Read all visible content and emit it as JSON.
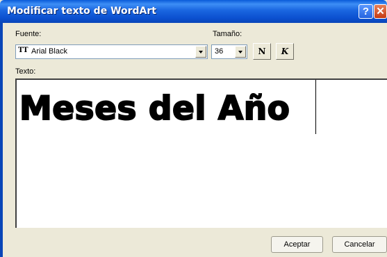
{
  "window": {
    "title": "Modificar texto de WordArt",
    "help_glyph": "?",
    "close_glyph": "✕"
  },
  "font": {
    "label": "Fuente:",
    "value": "Arial Black",
    "icon_glyph": "TT"
  },
  "size": {
    "label": "Tamaño:",
    "value": "36"
  },
  "format": {
    "bold_label": "N",
    "italic_label": "K"
  },
  "text": {
    "label": "Texto:",
    "value": "Meses del Año"
  },
  "buttons": {
    "ok": "Aceptar",
    "cancel": "Cancelar"
  }
}
